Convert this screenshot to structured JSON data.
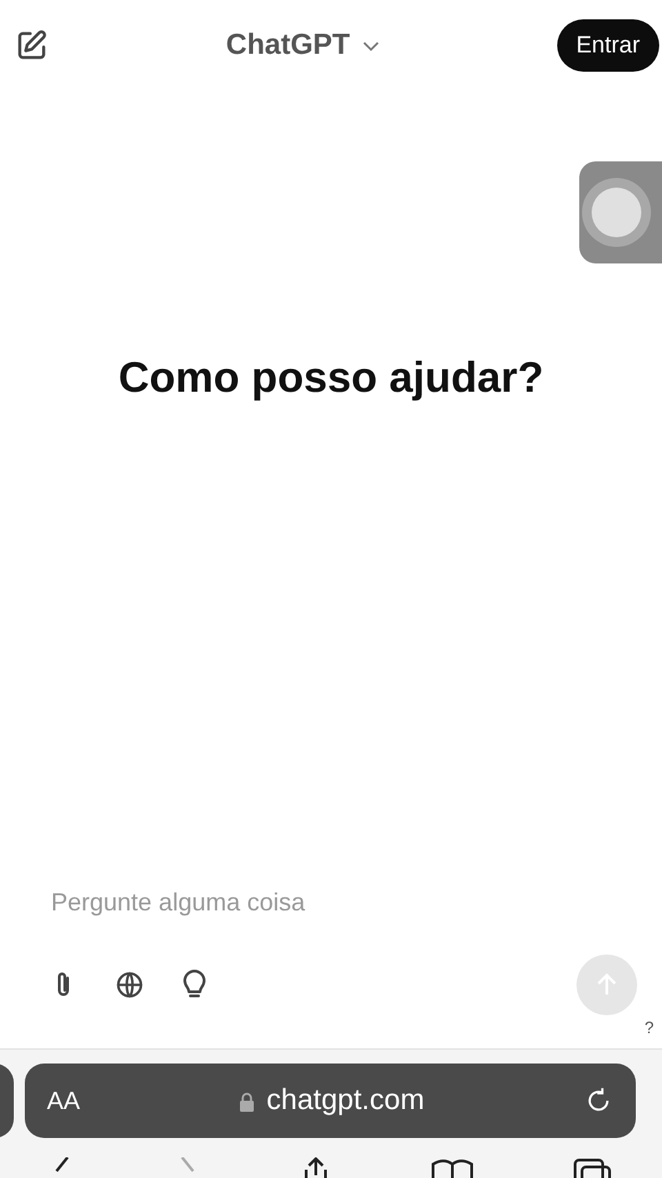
{
  "header": {
    "title": "ChatGPT",
    "login_button": "Entrar"
  },
  "heading": "Como posso ajudar?",
  "composer": {
    "placeholder": "Pergunte alguma coisa",
    "send_disabled": true
  },
  "help_mark": "?",
  "browser": {
    "text_size": "AA",
    "url": "chatgpt.com"
  }
}
